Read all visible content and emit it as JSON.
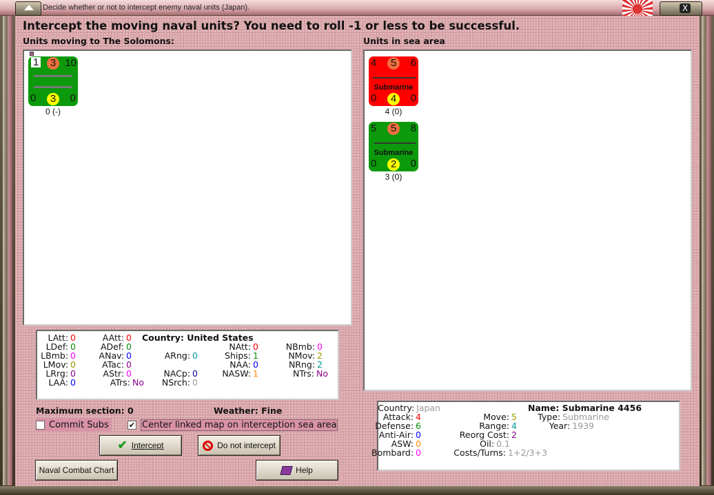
{
  "window": {
    "title": "Decide whether or not to intercept enemy naval units (Japan).",
    "close_label": "X"
  },
  "header": {
    "question": "Intercept the moving naval units?  You need to roll -1 or less to be successful.",
    "moving_label": "Units moving to The Solomons:",
    "sea_label": "Units in sea area"
  },
  "moving_units": [
    {
      "tl": "1",
      "tc": "3",
      "tr": "10",
      "bl": "0",
      "bc": "3",
      "br": "0",
      "label": "",
      "caption": "0 (-)",
      "color": "#0c9a0c"
    }
  ],
  "sea_units": [
    {
      "tl": "4",
      "tc": "5",
      "tr": "6",
      "bl": "0",
      "bc": "4",
      "br": "0",
      "label": "Submarine",
      "caption": "4 (0)",
      "color": "#ff0000"
    },
    {
      "tl": "5",
      "tc": "5",
      "tr": "8",
      "bl": "0",
      "bc": "2",
      "br": "0",
      "label": "Submarine",
      "caption": "3 (0)",
      "color": "#0c9a0c"
    }
  ],
  "us_stats": {
    "country": "Country: United States",
    "latt": [
      "LAtt:",
      "0"
    ],
    "ldef": [
      "LDef:",
      "0"
    ],
    "lbmb": [
      "LBmb:",
      "0"
    ],
    "lmov": [
      "LMov:",
      "0"
    ],
    "lrrg": [
      "LRrg:",
      "0"
    ],
    "laa": [
      "LAA:",
      "0"
    ],
    "aatt": [
      "AAtt:",
      "0"
    ],
    "adef": [
      "ADef:",
      "0"
    ],
    "anav": [
      "ANav:",
      "0"
    ],
    "atac": [
      "ATac:",
      "0"
    ],
    "astr": [
      "AStr:",
      "0"
    ],
    "atrs": [
      "ATrs:",
      "No"
    ],
    "arng": [
      "ARng:",
      "0"
    ],
    "nacp": [
      "NACp:",
      "0"
    ],
    "nsrch": [
      "NSrch:",
      "0"
    ],
    "natt": [
      "NAtt:",
      "0"
    ],
    "ships": [
      "Ships:",
      "1"
    ],
    "naa": [
      "NAA:",
      "0"
    ],
    "nasw": [
      "NASW:",
      "1"
    ],
    "nbmb": [
      "NBmb:",
      "0"
    ],
    "nmov": [
      "NMov:",
      "2"
    ],
    "nrng": [
      "NRng:",
      "2"
    ],
    "ntrs": [
      "NTrs:",
      "No"
    ]
  },
  "footer": {
    "max_section": "Maximum section: 0",
    "weather": "Weather:  Fine",
    "commit_subs": "Commit Subs",
    "commit_subs_checked": false,
    "center_map": "Center linked map on interception sea area",
    "center_map_checked": true,
    "intercept": "Intercept",
    "do_not_intercept": "Do not intercept",
    "naval_chart": "Naval Combat Chart",
    "help": "Help"
  },
  "unit_info": {
    "country": [
      "Country:",
      "Japan"
    ],
    "attack": [
      "Attack:",
      "4"
    ],
    "defense": [
      "Defense:",
      "6"
    ],
    "antiair": [
      "Anti-Air:",
      "0"
    ],
    "asw": [
      "ASW:",
      "0"
    ],
    "bombard": [
      "Bombard:",
      "0"
    ],
    "move": [
      "Move:",
      "5"
    ],
    "range": [
      "Range:",
      "4"
    ],
    "reorg": [
      "Reorg Cost:",
      "2"
    ],
    "oil": [
      "Oil:",
      "0.1"
    ],
    "costs": [
      "Costs/Turns:",
      "1+2/3+3"
    ],
    "name": "Name: Submarine 4456",
    "type": [
      "Type:",
      "Submarine"
    ],
    "year": [
      "Year:",
      "1939"
    ]
  }
}
